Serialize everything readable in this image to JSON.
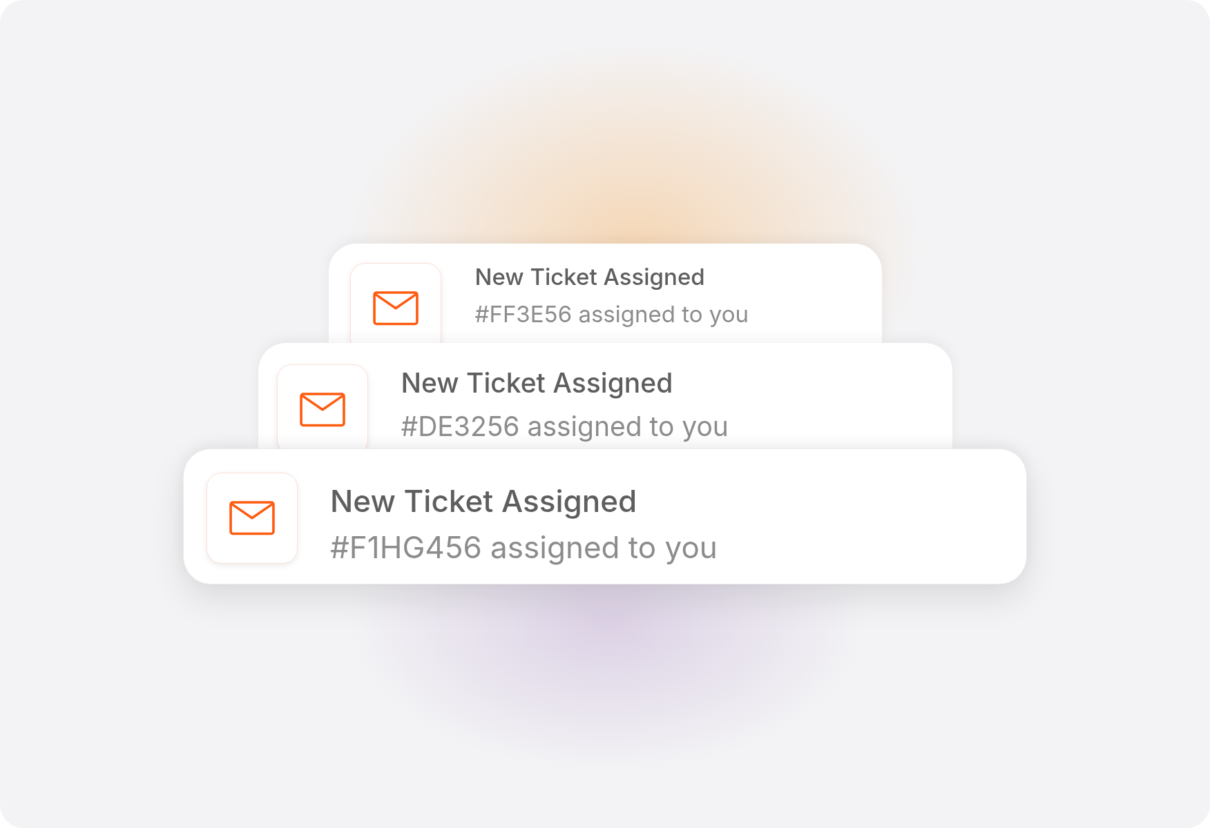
{
  "notifications": [
    {
      "title": "New Ticket Assigned",
      "message": "#FF3E56 assigned to you"
    },
    {
      "title": "New Ticket Assigned",
      "message": "#DE3256 assigned to you"
    },
    {
      "title": "New Ticket Assigned",
      "message": "#F1HG456 assigned to you"
    }
  ]
}
